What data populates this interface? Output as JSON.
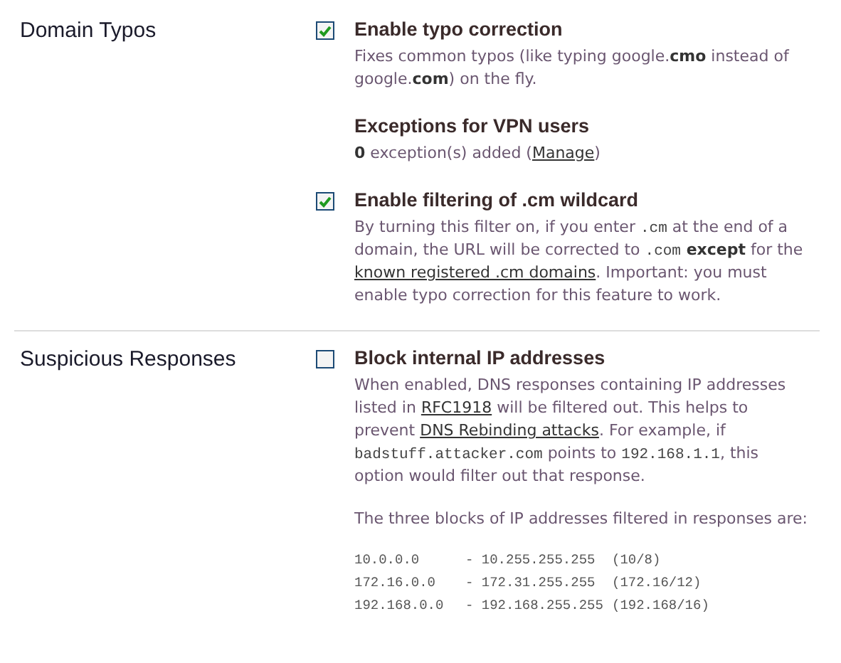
{
  "sections": [
    {
      "title": "Domain Typos",
      "items": [
        {
          "kind": "checkbox",
          "checked": true,
          "label": "Enable typo correction",
          "paragraphs": [
            [
              {
                "kind": "text",
                "text": "Fixes common typos (like typing google."
              },
              {
                "kind": "bold",
                "text": "cmo"
              },
              {
                "kind": "text",
                "text": " instead of google."
              },
              {
                "kind": "bold",
                "text": "com"
              },
              {
                "kind": "text",
                "text": ") on the fly."
              }
            ]
          ]
        },
        {
          "kind": "info",
          "label": "Exceptions for VPN users",
          "paragraphs": [
            [
              {
                "kind": "bold",
                "text": "0"
              },
              {
                "kind": "text",
                "text": " exception(s) added ("
              },
              {
                "kind": "link",
                "text": "Manage"
              },
              {
                "kind": "text",
                "text": ")"
              }
            ]
          ]
        },
        {
          "kind": "checkbox",
          "checked": true,
          "label": "Enable filtering of .cm wildcard",
          "paragraphs": [
            [
              {
                "kind": "text",
                "text": "By turning this filter on, if you enter "
              },
              {
                "kind": "mono",
                "text": ".cm"
              },
              {
                "kind": "text",
                "text": " at the end of a domain, the URL will be corrected to "
              },
              {
                "kind": "mono",
                "text": ".com"
              },
              {
                "kind": "bold",
                "text": " except"
              },
              {
                "kind": "text",
                "text": " for the "
              },
              {
                "kind": "link",
                "text": "known registered .cm domains"
              },
              {
                "kind": "text",
                "text": ". Important: you must enable typo correction for this feature to work."
              }
            ]
          ]
        }
      ]
    },
    {
      "title": "Suspicious Responses",
      "items": [
        {
          "kind": "checkbox",
          "checked": false,
          "label": "Block internal IP addresses",
          "paragraphs": [
            [
              {
                "kind": "text",
                "text": "When enabled, DNS responses containing IP addresses listed in "
              },
              {
                "kind": "link",
                "text": "RFC1918"
              },
              {
                "kind": "text",
                "text": " will be filtered out. This helps to prevent "
              },
              {
                "kind": "link",
                "text": "DNS Rebinding attacks"
              },
              {
                "kind": "text",
                "text": ". For example, if "
              },
              {
                "kind": "mono",
                "text": "badstuff.attacker.com"
              },
              {
                "kind": "text",
                "text": " points to "
              },
              {
                "kind": "mono",
                "text": "192.168.1.1"
              },
              {
                "kind": "text",
                "text": ", this option would filter out that response."
              }
            ],
            [
              {
                "kind": "text",
                "text": "The three blocks of IP addresses filtered in responses are:"
              }
            ]
          ],
          "ranges": [
            [
              "10.0.0.0",
              "- 10.255.255.255",
              "(10/8)"
            ],
            [
              "172.16.0.0",
              "- 172.31.255.255",
              "(172.16/12)"
            ],
            [
              "192.168.0.0",
              "- 192.168.255.255",
              "(192.168/16)"
            ]
          ]
        }
      ]
    }
  ]
}
